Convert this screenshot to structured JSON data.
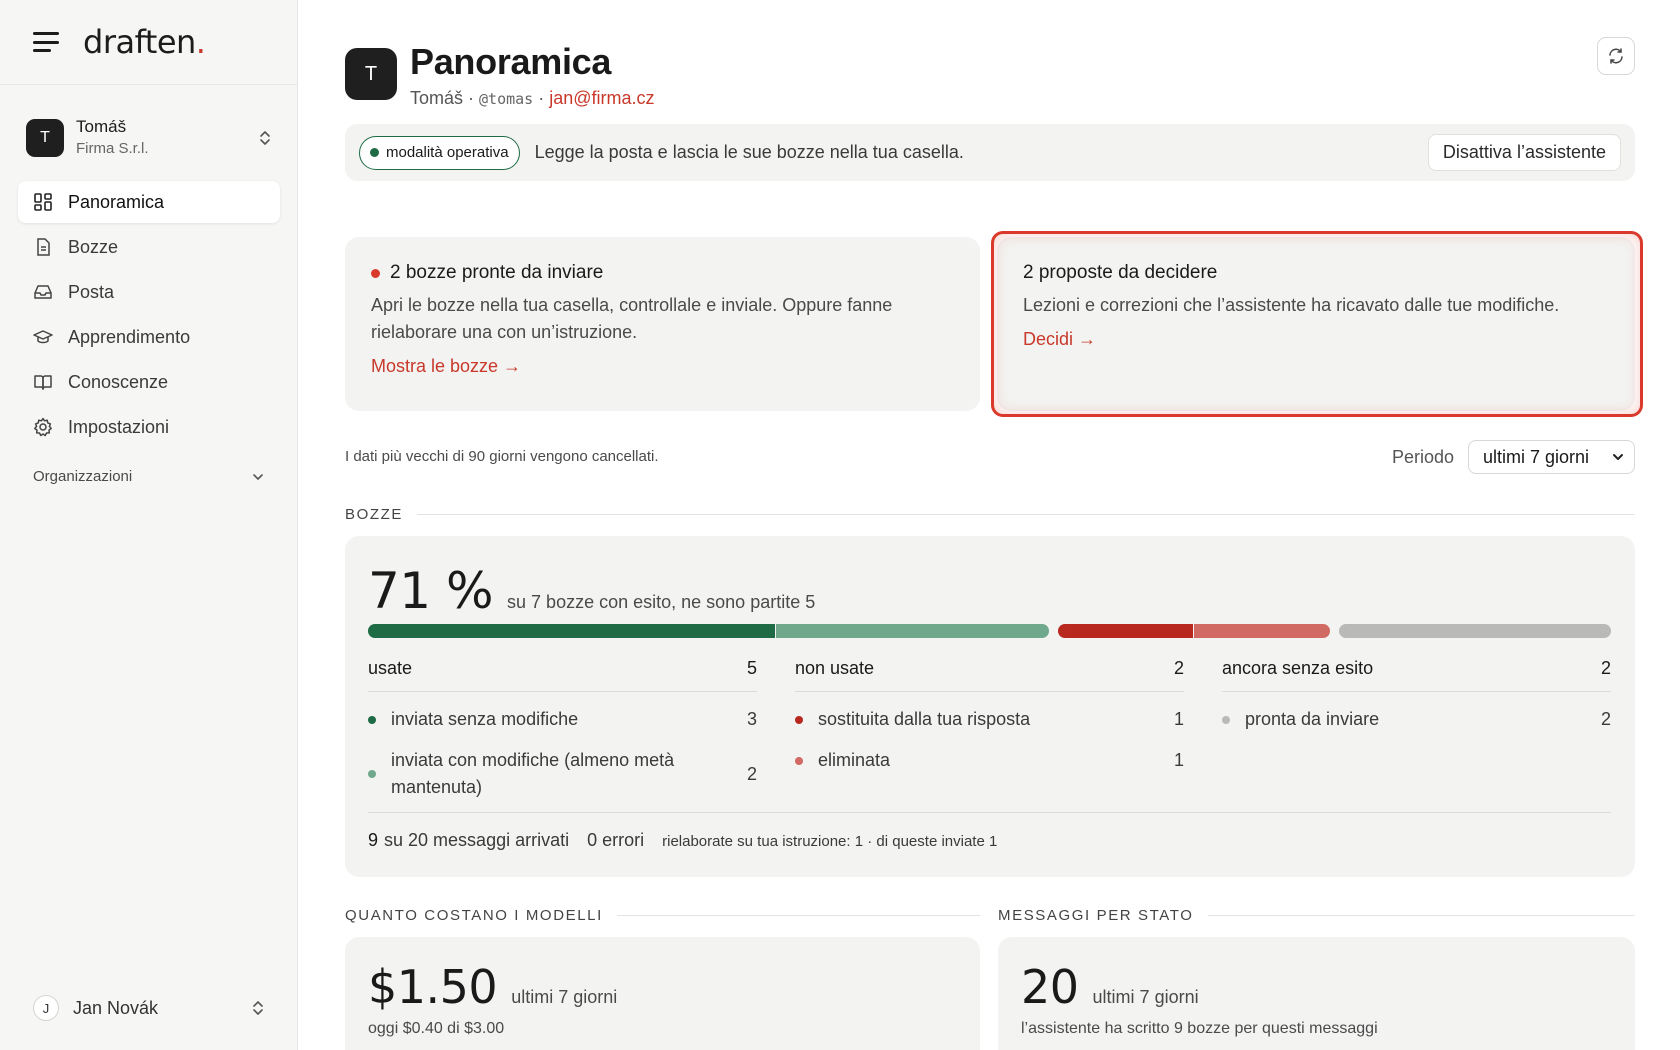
{
  "brand": {
    "name": "draften",
    "dot": "."
  },
  "account": {
    "initial": "T",
    "name": "Tomáš",
    "org": "Firma S.r.l."
  },
  "nav": [
    {
      "label": "Panoramica",
      "icon": "dashboard-icon",
      "active": true
    },
    {
      "label": "Bozze",
      "icon": "document-icon"
    },
    {
      "label": "Posta",
      "icon": "inbox-icon"
    },
    {
      "label": "Apprendimento",
      "icon": "graduation-cap-icon"
    },
    {
      "label": "Conoscenze",
      "icon": "book-icon"
    },
    {
      "label": "Impostazioni",
      "icon": "gear-icon"
    }
  ],
  "organizations_label": "Organizzazioni",
  "user": {
    "initial": "J",
    "name": "Jan Novák"
  },
  "header": {
    "initial": "T",
    "title": "Panoramica",
    "name": "Tomáš",
    "separator": " · ",
    "handle": "@tomas",
    "email": "jan@firma.cz"
  },
  "status": {
    "mode": "modalità operativa",
    "text": "Legge la posta e lascia le sue bozze nella tua casella.",
    "deactivate": "Disattiva l’assistente"
  },
  "cards": {
    "drafts": {
      "title": "2 bozze pronte da inviare",
      "desc": "Apri le bozze nella tua casella, controllale e inviale. Oppure fanne rielaborare una con un’istruzione.",
      "link": "Mostra le bozze →"
    },
    "proposals": {
      "title": "2 proposte da decidere",
      "desc": "Lezioni e correzioni che l’assistente ha ricavato dalle tue modifiche.",
      "link": "Decidi →"
    }
  },
  "retention": "I dati più vecchi di 90 giorni vengono cancellati.",
  "period": {
    "label": "Periodo",
    "value": "ultimi 7 giorni"
  },
  "bozze": {
    "section": "BOZZE",
    "percent": "71 %",
    "summary": "su 7 bozze con esito, ne sono partite 5",
    "bar": [
      {
        "value": 3,
        "color": "#1e6b45"
      },
      {
        "value": 2,
        "color": "#6fa88a"
      },
      {
        "value": 1,
        "color": "#b8281f"
      },
      {
        "value": 1,
        "color": "#d06a62"
      },
      {
        "value": 2,
        "color": "#b9b9b7"
      }
    ],
    "columns": [
      {
        "title": "usate",
        "count": "5",
        "items": [
          {
            "label": "inviata senza modifiche",
            "count": "3",
            "color": "#1e6b45"
          },
          {
            "label": "inviata con modifiche (almeno metà mantenuta)",
            "count": "2",
            "color": "#6fa88a"
          }
        ]
      },
      {
        "title": "non usate",
        "count": "2",
        "items": [
          {
            "label": "sostituita dalla tua risposta",
            "count": "1",
            "color": "#b8281f"
          },
          {
            "label": "eliminata",
            "count": "1",
            "color": "#d06a62"
          }
        ]
      },
      {
        "title": "ancora senza esito",
        "count": "2",
        "items": [
          {
            "label": "pronta da inviare",
            "count": "2",
            "color": "#b9b9b7"
          }
        ]
      }
    ],
    "footer": {
      "arrived_num": "9",
      "arrived_text": "su 20 messaggi arrivati",
      "errors": "0 errori",
      "reworked": "rielaborate su tua istruzione: 1 · di queste inviate 1"
    }
  },
  "costs": {
    "section": "QUANTO COSTANO I MODELLI",
    "amount": "$1.50",
    "period": "ultimi 7 giorni",
    "today": "oggi $0.40 di $3.00"
  },
  "messages": {
    "section": "MESSAGGI PER STATO",
    "count": "20",
    "period": "ultimi 7 giorni",
    "note": "l’assistente ha scritto 9 bozze per questi messaggi"
  }
}
